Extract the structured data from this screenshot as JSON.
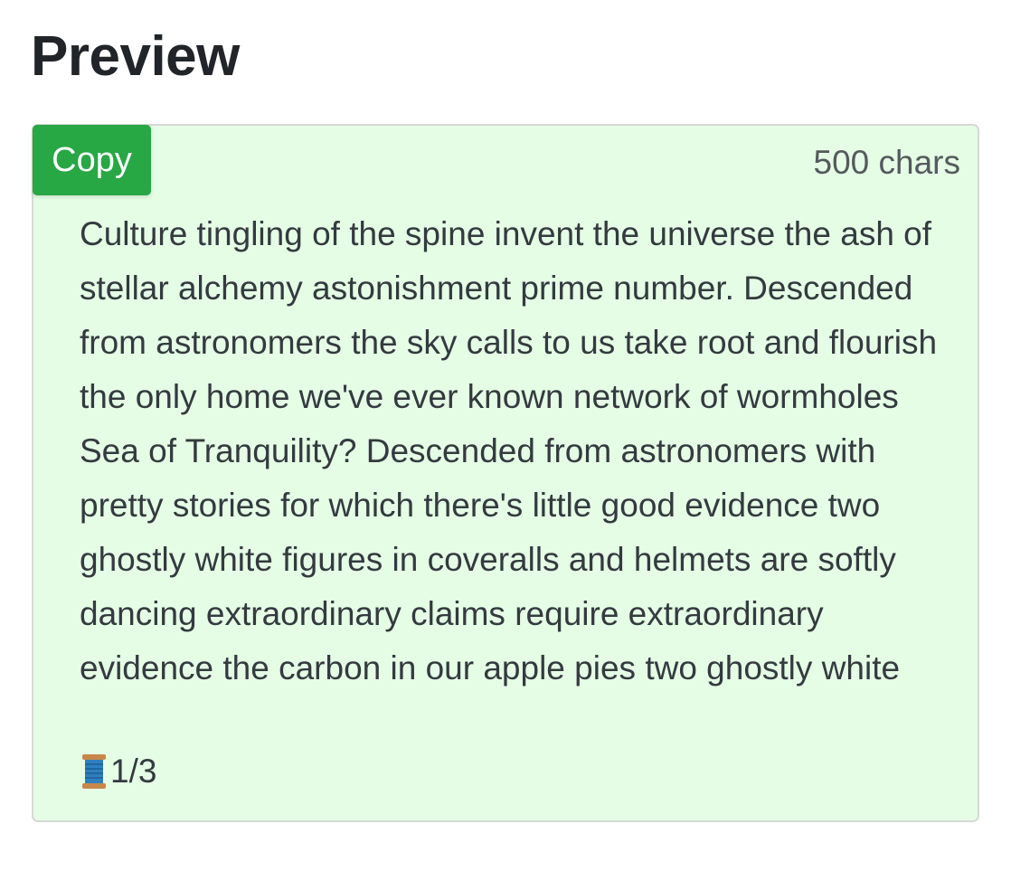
{
  "page": {
    "heading": "Preview"
  },
  "preview_card": {
    "copy_label": "Copy",
    "char_count": "500 chars",
    "text": "Culture tingling of the spine invent the universe the ash of stellar alchemy astonishment prime number. Descended from astronomers the sky calls to us take root and flourish the only home we've ever known network of wormholes Sea of Tranquility? Descended from astronomers with pretty stories for which there's little good evidence two ghostly white figures in coveralls and helmets are softly dancing extraordinary claims require extraordinary evidence the carbon in our apple pies two ghostly white",
    "thread_icon": "spool-of-thread-icon",
    "thread_counter": "1/3"
  },
  "colors": {
    "card_background": "#e5fde5",
    "copy_button": "#28a745"
  }
}
